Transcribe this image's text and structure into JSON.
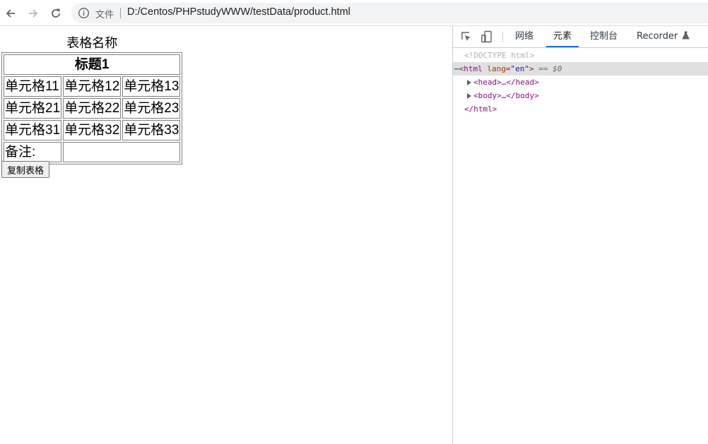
{
  "browser": {
    "url_scheme_label": "文件",
    "url": "D:/Centos/PHPstudyWWW/testData/product.html"
  },
  "page": {
    "table": {
      "caption": "表格名称",
      "header": "标题1",
      "rows": [
        [
          "单元格11",
          "单元格12",
          "单元格13"
        ],
        [
          "单元格21",
          "单元格22",
          "单元格23"
        ],
        [
          "单元格31",
          "单元格32",
          "单元格33"
        ]
      ],
      "remark_label": "备注:",
      "remark_value": ""
    },
    "copy_button_label": "复制表格"
  },
  "devtools": {
    "tabs": [
      "网络",
      "元素",
      "控制台",
      "Recorder"
    ],
    "active_tab": "元素",
    "dom": {
      "doctype": "<!DOCTYPE html>",
      "html_open_tag": "<html",
      "html_attr_name": "lang",
      "html_attr_value": "\"en\"",
      "html_open_end": ">",
      "selected_marker": "== $0",
      "dots": "⋯",
      "head_collapsed": "<head>…</head>",
      "body_collapsed": "<body>…</body>",
      "html_close_tag": "</html>"
    }
  },
  "icons": {
    "back": "back-arrow-icon",
    "forward": "forward-arrow-icon",
    "reload": "reload-icon",
    "info": "info-icon",
    "inspect": "inspect-element-icon",
    "device": "device-toolbar-icon",
    "recorder": "flask-icon"
  }
}
